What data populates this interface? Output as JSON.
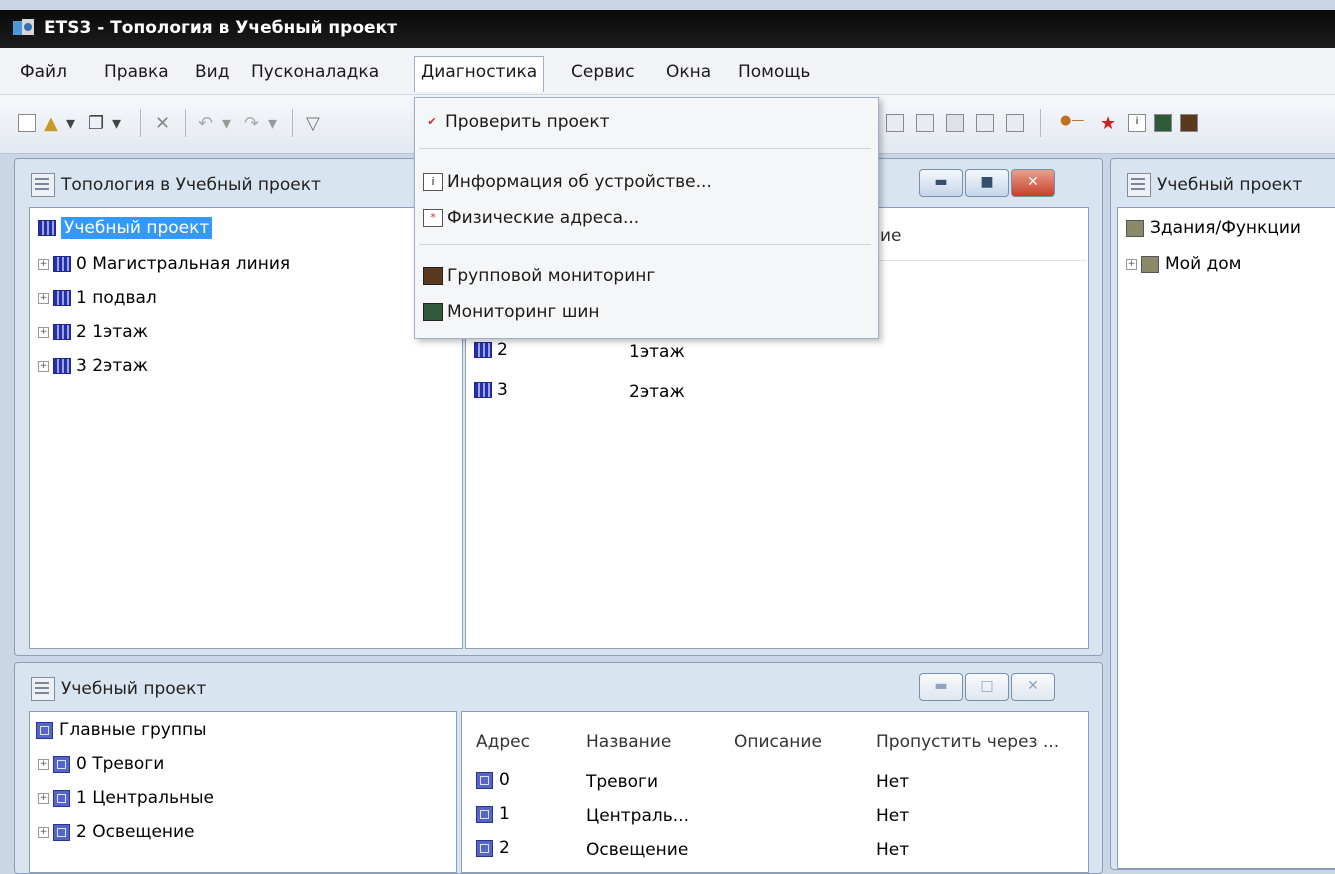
{
  "window": {
    "title": "ETS3 - Топология в Учебный проект"
  },
  "menu": [
    "Файл",
    "Правка",
    "Вид",
    "Пусконаладка",
    "Диагностика",
    "Сервис",
    "Окна",
    "Помощь"
  ],
  "dropdown": {
    "items": [
      "Проверить проект",
      "Информация об устройстве...",
      "Физические адреса...",
      "Групповой мониторинг",
      "Мониторинг шин"
    ]
  },
  "topology_window": {
    "title": "Топология в Учебный проект",
    "tree_root": "Учебный проект",
    "tree": [
      "0 Магистральная линия",
      "1 подвал",
      "2 1этаж",
      "3 2этаж"
    ],
    "list_header_fragment": "ие",
    "rows": [
      {
        "num": "2",
        "name": "1этаж"
      },
      {
        "num": "3",
        "name": "2этаж"
      }
    ]
  },
  "right_window": {
    "title": "Учебный проект",
    "tree_root": "Здания/Функции",
    "tree": [
      "Мой дом"
    ]
  },
  "groups_window": {
    "title": "Учебный проект",
    "tree_root": "Главные группы",
    "tree": [
      "0 Тревоги",
      "1 Центральные",
      "2 Освещение"
    ],
    "columns": [
      "Адрес",
      "Название",
      "Описание",
      "Пропустить через ..."
    ],
    "rows": [
      {
        "addr": "0",
        "name": "Тревоги",
        "skip": "Нет"
      },
      {
        "addr": "1",
        "name": "Централь...",
        "skip": "Нет"
      },
      {
        "addr": "2",
        "name": "Освещение",
        "skip": "Нет"
      }
    ]
  },
  "colors": {
    "selection": "#3399ff",
    "titlebar": "#111111",
    "accent": "#2630a8"
  }
}
